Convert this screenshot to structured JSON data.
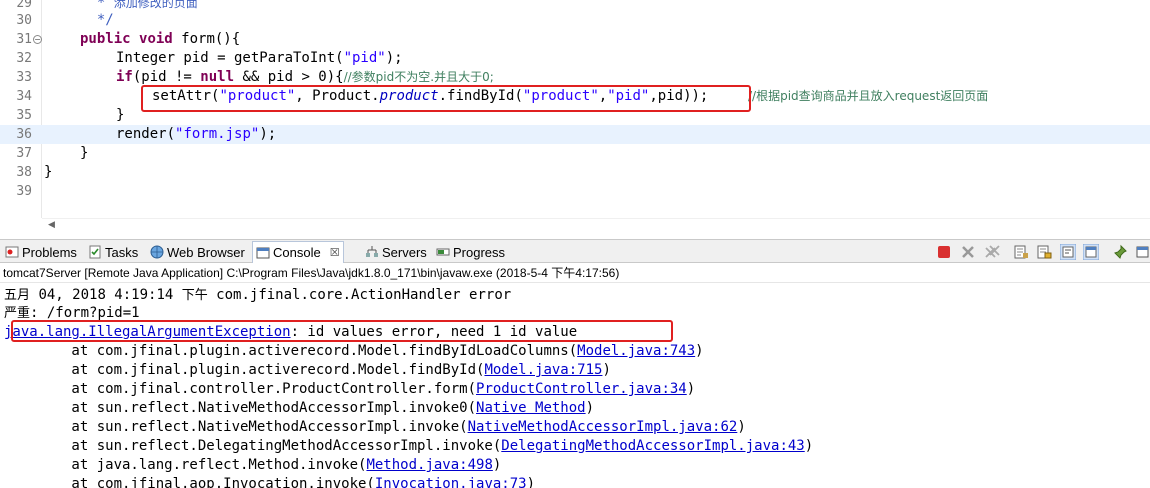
{
  "editor": {
    "lines": [
      {
        "num": "29",
        "fold": false
      },
      {
        "num": "30",
        "fold": false
      },
      {
        "num": "31",
        "fold": true
      },
      {
        "num": "32",
        "fold": false
      },
      {
        "num": "33",
        "fold": false
      },
      {
        "num": "34",
        "fold": false
      },
      {
        "num": "35",
        "fold": false
      },
      {
        "num": "36",
        "fold": false
      },
      {
        "num": "37",
        "fold": false
      },
      {
        "num": "38",
        "fold": false
      },
      {
        "num": "39",
        "fold": false
      }
    ],
    "code": {
      "l29_star": "  * ",
      "l29_text": "添加修改的页面",
      "l30": "  */",
      "l31_kw1": "public",
      "l31_kw2": "void",
      "l31_rest": " form(){",
      "l32_pre": "Integer pid = getParaToInt(",
      "l32_str": "\"pid\"",
      "l32_post": ");",
      "l33_if": "if",
      "l33_a": "(pid != ",
      "l33_null": "null",
      "l33_b": " && pid > 0){",
      "l33_cmt": "//参数pid不为空.并且大于0;",
      "l34_a": "setAttr(",
      "l34_s1": "\"product\"",
      "l34_b": ", Product.",
      "l34_field": "product",
      "l34_c": ".findById(",
      "l34_s2": "\"product\"",
      "l34_d": ",",
      "l34_s3": "\"pid\"",
      "l34_e": ",pid));",
      "l34_cmt": "//根据pid查询商品并且放入request返回页面",
      "l35": "}",
      "l36_a": "render(",
      "l36_s": "\"form.jsp\"",
      "l36_b": ");",
      "l37": "}",
      "l38": "}"
    }
  },
  "views": {
    "tabs": [
      {
        "label": "Problems",
        "icon": "problems-icon"
      },
      {
        "label": "Tasks",
        "icon": "tasks-icon"
      },
      {
        "label": "Web Browser",
        "icon": "globe-icon"
      },
      {
        "label": "Console",
        "icon": "console-icon",
        "active": true
      },
      {
        "label": "Servers",
        "icon": "servers-icon"
      },
      {
        "label": "Progress",
        "icon": "progress-icon"
      }
    ],
    "close_glyph": "☒"
  },
  "console": {
    "header": "tomcat7Server [Remote Java Application] C:\\Program Files\\Java\\jdk1.8.0_171\\bin\\javaw.exe (2018-5-4 下午4:17:56)",
    "line1_a": "五月",
    "line1_b": " 04, 2018 4:19:14 ",
    "line1_c": "下午",
    "line1_d": " com.jfinal.core.ActionHandler error",
    "line2_a": "严重",
    "line2_b": ": /form?pid=1",
    "exception_link": "java.lang.IllegalArgumentException",
    "exception_msg": ": id values error, need 1 id value",
    "stack": [
      {
        "prefix": "\tat com.jfinal.plugin.activerecord.Model.findByIdLoadColumns(",
        "link": "Model.java:743",
        "suffix": ")"
      },
      {
        "prefix": "\tat com.jfinal.plugin.activerecord.Model.findById(",
        "link": "Model.java:715",
        "suffix": ")"
      },
      {
        "prefix": "\tat com.jfinal.controller.ProductController.form(",
        "link": "ProductController.java:34",
        "suffix": ")"
      },
      {
        "prefix": "\tat sun.reflect.NativeMethodAccessorImpl.invoke0(",
        "link": "Native Method",
        "suffix": ")"
      },
      {
        "prefix": "\tat sun.reflect.NativeMethodAccessorImpl.invoke(",
        "link": "NativeMethodAccessorImpl.java:62",
        "suffix": ")"
      },
      {
        "prefix": "\tat sun.reflect.DelegatingMethodAccessorImpl.invoke(",
        "link": "DelegatingMethodAccessorImpl.java:43",
        "suffix": ")"
      },
      {
        "prefix": "\tat java.lang.reflect.Method.invoke(",
        "link": "Method.java:498",
        "suffix": ")"
      },
      {
        "prefix": "\tat com.jfinal.aop.Invocation.invoke(",
        "link": "Invocation.java:73",
        "suffix": ")"
      }
    ]
  },
  "colors": {
    "highlight_box": "#e02020",
    "current_line": "#e8f2fe",
    "keyword": "#7f0055",
    "string": "#2a00ff",
    "comment": "#3f7f5f",
    "link": "#0000cc"
  }
}
